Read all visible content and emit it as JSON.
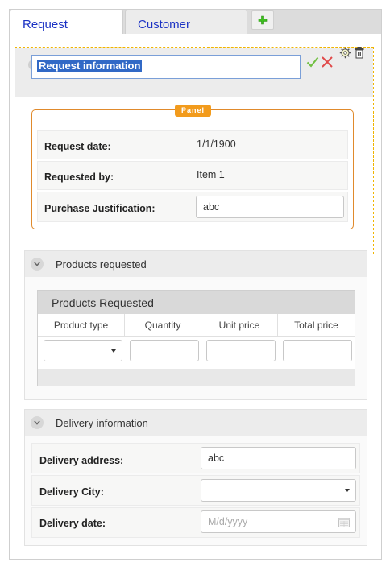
{
  "tabs": [
    {
      "label": "Request",
      "active": true
    },
    {
      "label": "Customer",
      "active": false
    }
  ],
  "request_section": {
    "title_value": "Request information",
    "panel_label": "Panel",
    "fields": {
      "request_date": {
        "label": "Request date:",
        "value": "1/1/1900"
      },
      "requested_by": {
        "label": "Requested by:",
        "value": "Item 1"
      },
      "justification": {
        "label": "Purchase Justification:",
        "value": "abc"
      }
    }
  },
  "products_section": {
    "title": "Products requested",
    "grid_title": "Products Requested",
    "columns": [
      "Product type",
      "Quantity",
      "Unit price",
      "Total price"
    ]
  },
  "delivery_section": {
    "title": "Delivery information",
    "fields": {
      "address": {
        "label": "Delivery address:",
        "value": "abc"
      },
      "city": {
        "label": "Delivery City:",
        "value": ""
      },
      "date": {
        "label": "Delivery date:",
        "placeholder": "M/d/yyyy"
      }
    }
  },
  "colors": {
    "accent": "#1b32c4",
    "panel_border": "#e08a2c",
    "selection": "#f0b400",
    "badge": "#f29b1c"
  },
  "icons": [
    "add-tab-icon",
    "settings-icon",
    "trash-icon",
    "checkmark-icon",
    "close-icon",
    "chevron-down-icon",
    "calendar-icon"
  ]
}
